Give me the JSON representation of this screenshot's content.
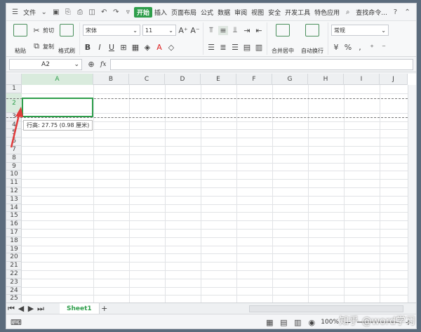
{
  "menu": {
    "file": "文件",
    "tabs": [
      "开始",
      "插入",
      "页面布局",
      "公式",
      "数据",
      "审阅",
      "视图",
      "安全",
      "开发工具",
      "特色应用"
    ],
    "search": "查找命令..."
  },
  "ribbon": {
    "paste": "粘贴",
    "cut": "剪切",
    "copy": "复制",
    "format_painter": "格式刷",
    "font_name": "宋体",
    "font_size": "11",
    "merge_center": "合并居中",
    "wrap_text": "自动换行",
    "number_format": "常规"
  },
  "formula": {
    "cell_ref": "A2",
    "fx": "fx"
  },
  "columns": [
    "A",
    "B",
    "C",
    "D",
    "E",
    "F",
    "G",
    "H",
    "I",
    "J"
  ],
  "rows": [
    "1",
    "2",
    "3",
    "4",
    "5",
    "6",
    "7",
    "8",
    "9",
    "10",
    "11",
    "12",
    "13",
    "14",
    "15",
    "16",
    "17",
    "18",
    "19",
    "20",
    "21",
    "22",
    "23",
    "24",
    "25"
  ],
  "tooltip": "行高: 27.75 (0.98 厘米)",
  "sheet_tab": "Sheet1",
  "status": {
    "zoom": "100%"
  },
  "watermark": "知乎 @word学习",
  "accent_color": "#2e9e4b"
}
